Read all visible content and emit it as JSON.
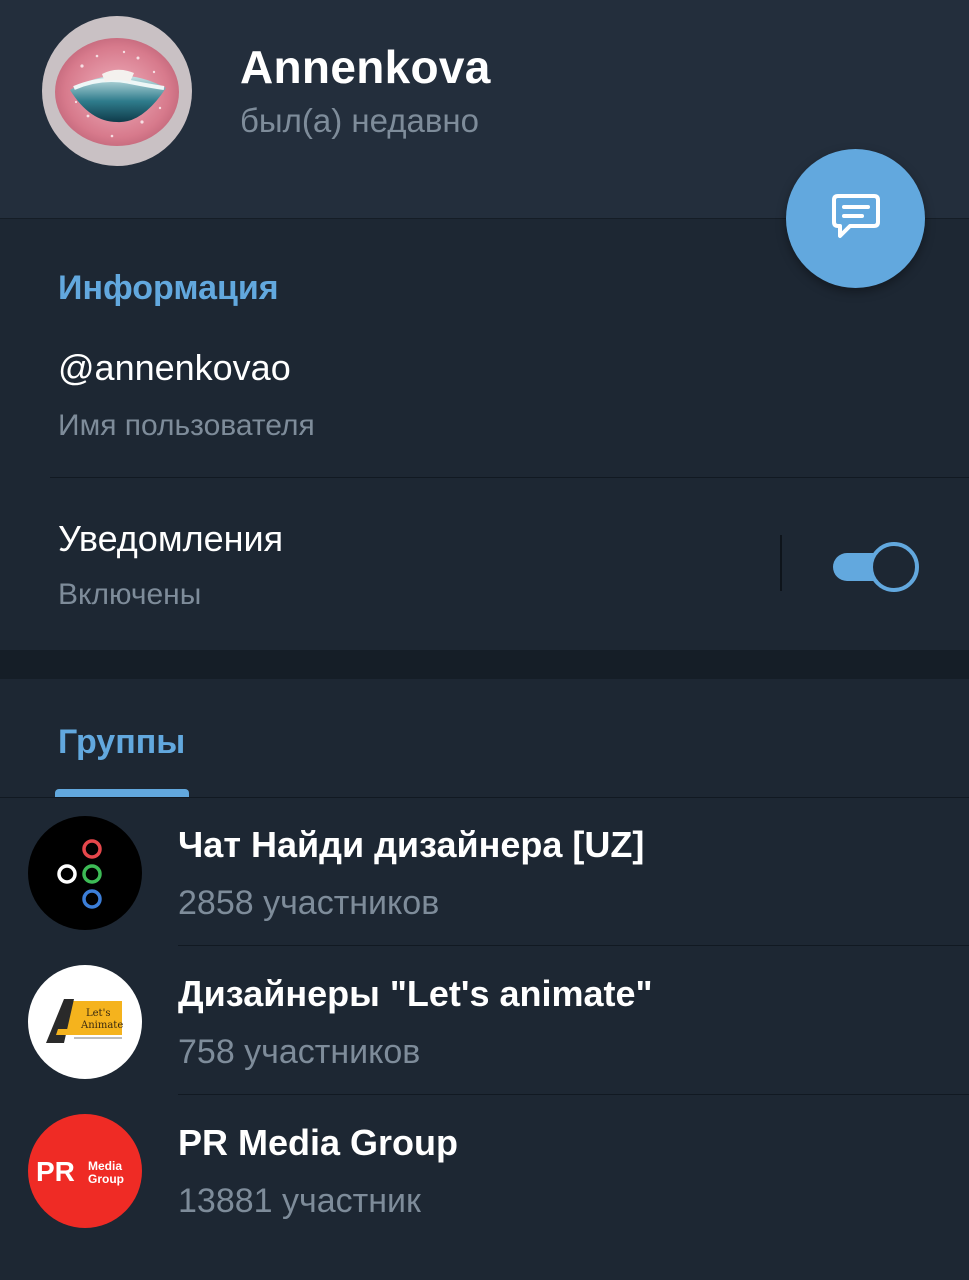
{
  "profile": {
    "name": "Annenkova",
    "status": "был(а) недавно"
  },
  "info": {
    "title": "Информация",
    "username": "@annenkovao",
    "username_caption": "Имя пользователя",
    "notifications_label": "Уведомления",
    "notifications_status": "Включены",
    "notifications_enabled": true
  },
  "groups": {
    "tab_label": "Группы",
    "items": [
      {
        "name": "Чат Найди дизайнера [UZ]",
        "members": "2858 участников"
      },
      {
        "name": "Дизайнеры \"Let's animate\"",
        "members": "758 участников",
        "logo_text_1": "Let's",
        "logo_text_2": "Animate"
      },
      {
        "name": "PR Media Group",
        "members": "13881 участник",
        "logo_text_1": "PR",
        "logo_text_2": "Media",
        "logo_text_3": "Group"
      }
    ]
  },
  "colors": {
    "accent": "#62a8de",
    "background": "#1d2733",
    "header_bg": "#232e3c",
    "secondary_text": "#7e8c9a"
  },
  "icons": {
    "fab": "message-icon"
  }
}
